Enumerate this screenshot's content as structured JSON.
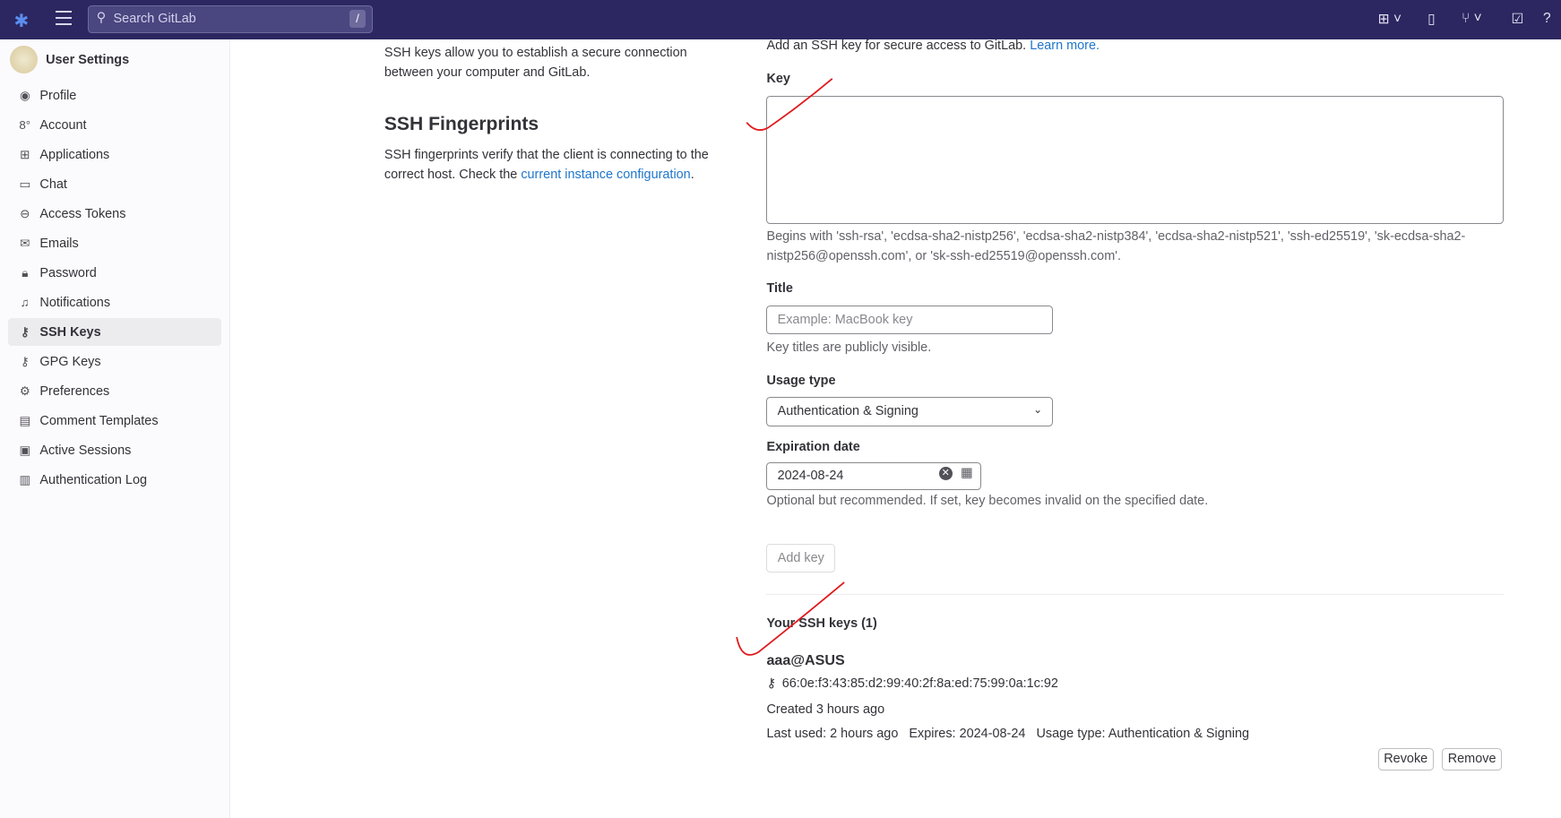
{
  "header": {
    "search_placeholder": "Search GitLab",
    "search_shortcut": "/",
    "icons": [
      "gitlab-logo",
      "menu-icon",
      "search-icon",
      "plus-square-icon",
      "issues-icon",
      "merge-request-icon",
      "todo-icon",
      "help-icon"
    ]
  },
  "sidebar": {
    "title": "User Settings",
    "items": [
      {
        "label": "Profile",
        "icon": "user-circle"
      },
      {
        "label": "Account",
        "icon": "account"
      },
      {
        "label": "Applications",
        "icon": "applications"
      },
      {
        "label": "Chat",
        "icon": "comment"
      },
      {
        "label": "Access Tokens",
        "icon": "token"
      },
      {
        "label": "Emails",
        "icon": "mail"
      },
      {
        "label": "Password",
        "icon": "lock"
      },
      {
        "label": "Notifications",
        "icon": "bell"
      },
      {
        "label": "SSH Keys",
        "icon": "key",
        "active": true
      },
      {
        "label": "GPG Keys",
        "icon": "key"
      },
      {
        "label": "Preferences",
        "icon": "preferences"
      },
      {
        "label": "Comment Templates",
        "icon": "comment-lines"
      },
      {
        "label": "Active Sessions",
        "icon": "monitor"
      },
      {
        "label": "Authentication Log",
        "icon": "log"
      }
    ]
  },
  "left": {
    "ssh_desc": "SSH keys allow you to establish a secure connection between your computer and GitLab.",
    "fp_title": "SSH Fingerprints",
    "fp_desc": "SSH fingerprints verify that the client is connecting to the correct host. Check the ",
    "fp_link": "current instance configuration",
    "fp_end": "."
  },
  "form": {
    "intro": "Add an SSH key for secure access to GitLab. ",
    "intro_link": "Learn more.",
    "key_label": "Key",
    "key_value": "",
    "key_help": "Begins with 'ssh-rsa', 'ecdsa-sha2-nistp256', 'ecdsa-sha2-nistp384', 'ecdsa-sha2-nistp521', 'ssh-ed25519', 'sk-ecdsa-sha2-nistp256@openssh.com', or 'sk-ssh-ed25519@openssh.com'.",
    "title_label": "Title",
    "title_placeholder": "Example: MacBook key",
    "title_help": "Key titles are publicly visible.",
    "usage_label": "Usage type",
    "usage_value": "Authentication & Signing",
    "exp_label": "Expiration date",
    "exp_value": "2024-08-24",
    "exp_help": "Optional but recommended. If set, key becomes invalid on the specified date.",
    "add_button": "Add key"
  },
  "keys": {
    "heading": "Your SSH keys (1)",
    "items": [
      {
        "title": "aaa@ASUS",
        "fingerprint": "66:0e:f3:43:85:d2:99:40:2f:8a:ed:75:99:0a:1c:92",
        "created": "Created 3 hours ago",
        "last_used": "Last used: 2 hours ago",
        "expires": "Expires: 2024-08-24",
        "usage": "Usage type: Authentication & Signing",
        "revoke": "Revoke",
        "remove": "Remove"
      }
    ]
  },
  "annotation_color": "#e0191c"
}
